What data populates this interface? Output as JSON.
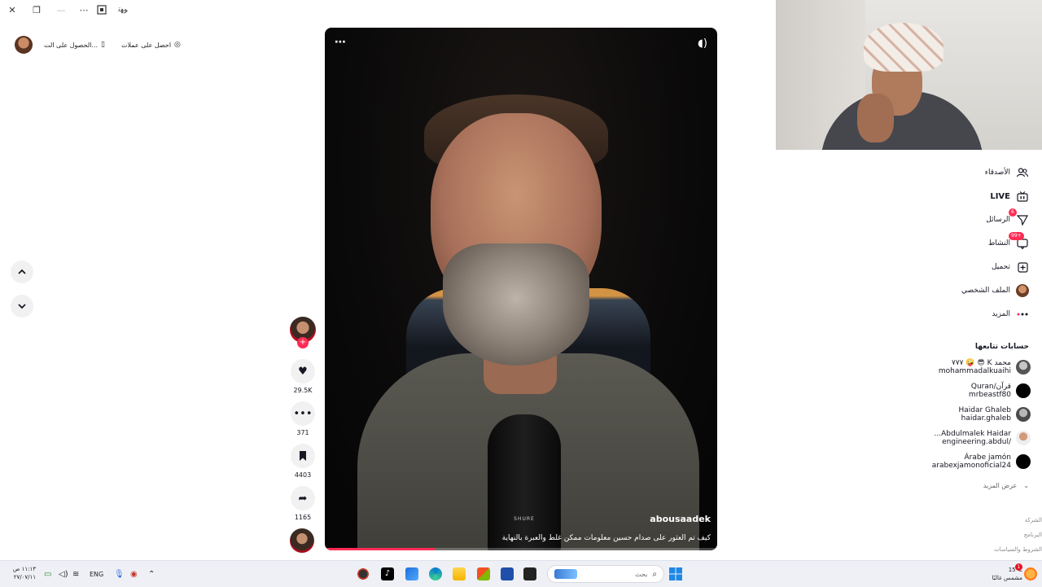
{
  "titlebar": {
    "close": "✕",
    "restore": "❐",
    "minimize": "—",
    "more": "⋯",
    "icons": [
      "window-snap-icon",
      "translate-icon"
    ],
    "app_label": "ﻮﮭﺗ"
  },
  "top_pills": {
    "get_coins": "احصل على عملات",
    "get_app": "الحصول على الت..."
  },
  "video": {
    "author": "abousaadek",
    "caption": "كيف تم العثور على صدام حسين معلومات ممكن غلط والعبرة بالنهاية",
    "mic_label": "SHURE",
    "progress": 0.28
  },
  "actions": {
    "likes": "29.5K",
    "comments": "371",
    "saves": "4403",
    "shares": "1165"
  },
  "sidebar": {
    "nav": [
      {
        "label": "الأصدقاء",
        "icon": "friends-icon"
      },
      {
        "label": "LIVE",
        "icon": "live-icon"
      },
      {
        "label": "الرسائل",
        "icon": "messages-icon",
        "badge": "6"
      },
      {
        "label": "النشاط",
        "icon": "activity-icon",
        "badge": "99+"
      },
      {
        "label": "تحميل",
        "icon": "upload-icon"
      },
      {
        "label": "الملف الشخصي",
        "icon": "profile-icon"
      },
      {
        "label": "المزيد",
        "icon": "more-icon"
      }
    ],
    "following_title": "حسابات تتابعها",
    "following": [
      {
        "name": "محمد K 😎 🤪 ٧٧٧",
        "username": "mohammadalkuaihi"
      },
      {
        "name": "قرآن/Quran",
        "username": "mrbeastf80"
      },
      {
        "name": "Haidar Ghaleb",
        "username": "haidar.ghaleb"
      },
      {
        "name": "Abdulmalek Haidar...",
        "username": "engineering.abdul/"
      },
      {
        "name": "Árabe jamón",
        "username": "arabexjamonoficial24"
      }
    ],
    "see_more": "عرض المزيد",
    "footer": [
      "الشركة",
      "البرنامج",
      "الشروط والسياسات"
    ]
  },
  "taskbar": {
    "time": "١١:١٣ ص",
    "date": "٢٧/٠٧/١١",
    "lang": "ENG",
    "search_placeholder": "بحث",
    "weather_temp": "15°C",
    "weather_desc": "مشمس غالبًا",
    "notifications": "1"
  }
}
